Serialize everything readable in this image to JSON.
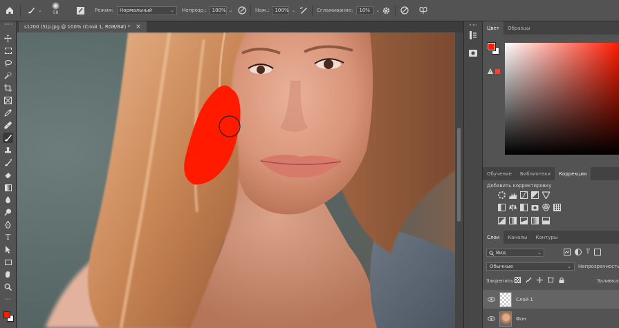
{
  "options_bar": {
    "brush_size": "58",
    "mode_label": "Режим:",
    "mode_value": "Нормальный",
    "opacity_label": "Непрозр.:",
    "opacity_value": "100%",
    "pressure_label": "Наж.:",
    "pressure_value": "100%",
    "smoothing_label": "Сглаживание:",
    "smoothing_value": "10%"
  },
  "document": {
    "tab_title": "s1200 (5)p.jpg @ 100% (Слой 1, RGB/8#) *",
    "close_glyph": "×"
  },
  "color_panel": {
    "tabs": [
      "Цвет",
      "Образцы"
    ],
    "foreground": "#ff1a00",
    "background": "#ffffff"
  },
  "adjustments_panel": {
    "tabs": [
      "Обучение",
      "Библиотеки",
      "Коррекция"
    ],
    "title": "Добавить корректировку"
  },
  "layers_panel": {
    "tabs": [
      "Слои",
      "Каналы",
      "Контуры"
    ],
    "filter": "Вид",
    "blend_mode": "Обычные",
    "opacity_label": "Непрозрачность:",
    "lock_label": "Закрепить:",
    "fill_label": "Заливка:",
    "layers": [
      {
        "name": "Слой 1",
        "selected": true
      },
      {
        "name": "Фон",
        "selected": false
      }
    ]
  },
  "colors": {
    "ui_bg": "#535353",
    "panel_dark": "#424242",
    "brush_red": "#ff1a00"
  }
}
